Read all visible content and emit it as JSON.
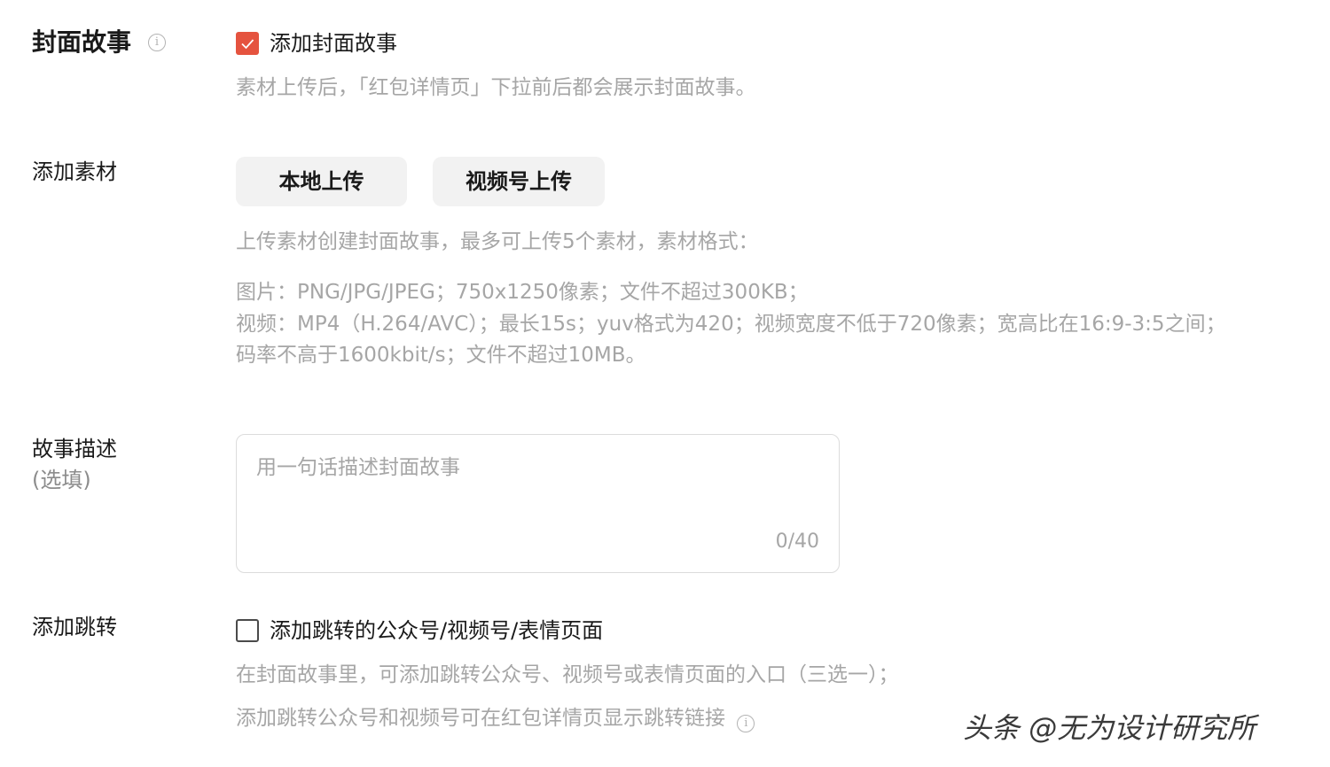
{
  "cover_story": {
    "label": "封面故事",
    "checkbox_label": "添加封面故事",
    "checked": true,
    "hint": "素材上传后，「红包详情页」下拉前后都会展示封面故事。"
  },
  "add_material": {
    "label": "添加素材",
    "local_upload_label": "本地上传",
    "channel_upload_label": "视频号上传",
    "hint_intro": "上传素材创建封面故事，最多可上传5个素材，素材格式：",
    "hint_image": "图片：PNG/JPG/JPEG；750x1250像素；文件不超过300KB；",
    "hint_video_line1": "视频：MP4（H.264/AVC）；最长15s；yuv格式为420；视频宽度不低于720像素；宽高比在16:9-3:5之间；",
    "hint_video_line2": "码率不高于1600kbit/s；文件不超过10MB。"
  },
  "story_desc": {
    "label": "故事描述",
    "sub_label": "(选填)",
    "placeholder": "用一句话描述封面故事",
    "counter": "0/40"
  },
  "add_jump": {
    "label": "添加跳转",
    "checkbox_label": "添加跳转的公众号/视频号/表情页面",
    "checked": false,
    "hint1": "在封面故事里，可添加跳转公众号、视频号或表情页面的入口（三选一）；",
    "hint2": "添加跳转公众号和视频号可在红包详情页显示跳转链接"
  },
  "watermark": "头条 @无为设计研究所",
  "colors": {
    "accent": "#e5533f",
    "hint_text": "#a6a6a6",
    "button_bg": "#f2f2f2"
  }
}
